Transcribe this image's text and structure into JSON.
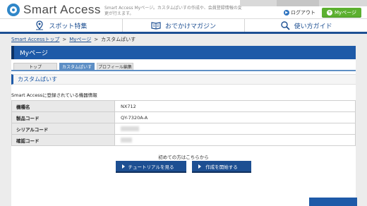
{
  "header": {
    "logo_text": "Smart Access",
    "tagline": "Smart Access Myページ。カスタムぱいすの作成や、会員登録情報の変更が行えます。",
    "logout_label": "ログアウト",
    "mypage_label": "Myページ"
  },
  "nav": {
    "items": [
      {
        "label": "スポット特集",
        "icon": "map-pin-icon"
      },
      {
        "label": "おでかけマガジン",
        "icon": "book-icon"
      },
      {
        "label": "使い方ガイド",
        "icon": "search-icon"
      }
    ]
  },
  "breadcrumb": {
    "items": [
      "Smart Accessトップ",
      "Myページ",
      "カスタムぱいす"
    ],
    "separator": ">"
  },
  "page": {
    "title": "Myページ",
    "tabs": [
      {
        "label": "トップ",
        "active": false
      },
      {
        "label": "カスタムぱいす",
        "active": true
      },
      {
        "label": "プロフィール編集",
        "active": false
      }
    ],
    "section_title": "カスタムぱいす",
    "info_label": "Smart Accessに登録されている機器情報"
  },
  "device_table": {
    "rows": [
      {
        "key": "機種名",
        "value": "NX712"
      },
      {
        "key": "製品コード",
        "value": "QY-7320A-A"
      },
      {
        "key": "シリアルコード",
        "value": ""
      },
      {
        "key": "確認コード",
        "value": ""
      }
    ]
  },
  "cta": {
    "first_time": "初めての方はこちらから",
    "tutorial_label": "チュートリアルを見る",
    "create_label": "作成を開始する"
  },
  "colors": {
    "brand_blue": "#1e5aa8",
    "nav_blue": "#1d4f92",
    "mypage_green": "#5cb030"
  }
}
